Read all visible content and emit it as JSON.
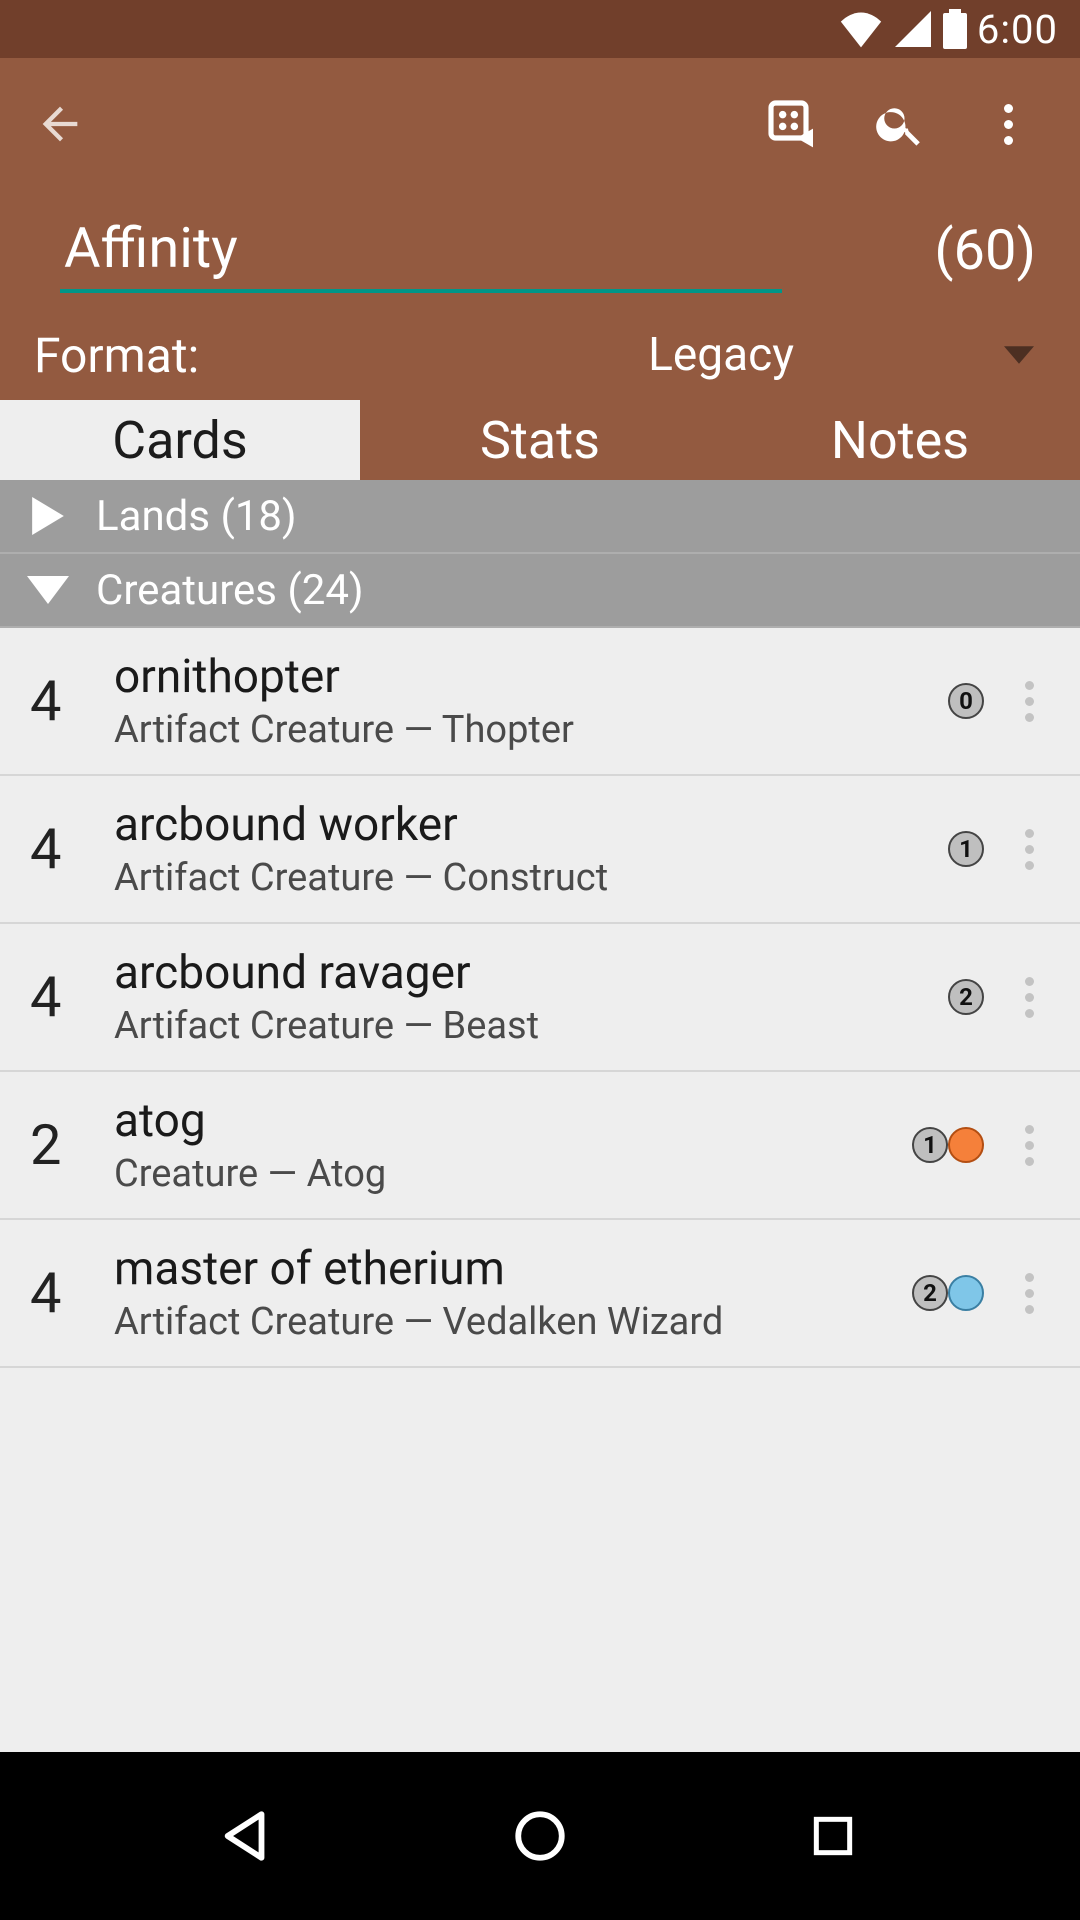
{
  "status": {
    "time": "6:00"
  },
  "header": {
    "deck_name": "Affinity",
    "count": "(60)",
    "format_label": "Format:",
    "format_value": "Legacy"
  },
  "tabs": {
    "cards": "Cards",
    "stats": "Stats",
    "notes": "Notes",
    "active": "cards"
  },
  "sections": [
    {
      "label": "Lands (18)",
      "expanded": false
    },
    {
      "label": "Creatures (24)",
      "expanded": true
    }
  ],
  "cards": [
    {
      "qty": "4",
      "name": "ornithopter",
      "type": "Artifact Creature — Thopter",
      "cost": [
        {
          "t": "num",
          "v": "0"
        }
      ]
    },
    {
      "qty": "4",
      "name": "arcbound worker",
      "type": "Artifact Creature  — Construct",
      "cost": [
        {
          "t": "num",
          "v": "1"
        }
      ]
    },
    {
      "qty": "4",
      "name": "arcbound ravager",
      "type": "Artifact Creature  — Beast",
      "cost": [
        {
          "t": "num",
          "v": "2"
        }
      ]
    },
    {
      "qty": "2",
      "name": "atog",
      "type": "Creature  — Atog",
      "cost": [
        {
          "t": "num",
          "v": "1"
        },
        {
          "t": "red"
        }
      ]
    },
    {
      "qty": "4",
      "name": "master of etherium",
      "type": "Artifact Creature  — Vedalken Wizard",
      "cost": [
        {
          "t": "num",
          "v": "2"
        },
        {
          "t": "blue"
        }
      ]
    }
  ],
  "icons": {
    "back": "back-arrow-icon",
    "tutor": "life-counter-icon",
    "search": "search-icon",
    "overflow": "overflow-icon",
    "add": "plus-icon"
  }
}
